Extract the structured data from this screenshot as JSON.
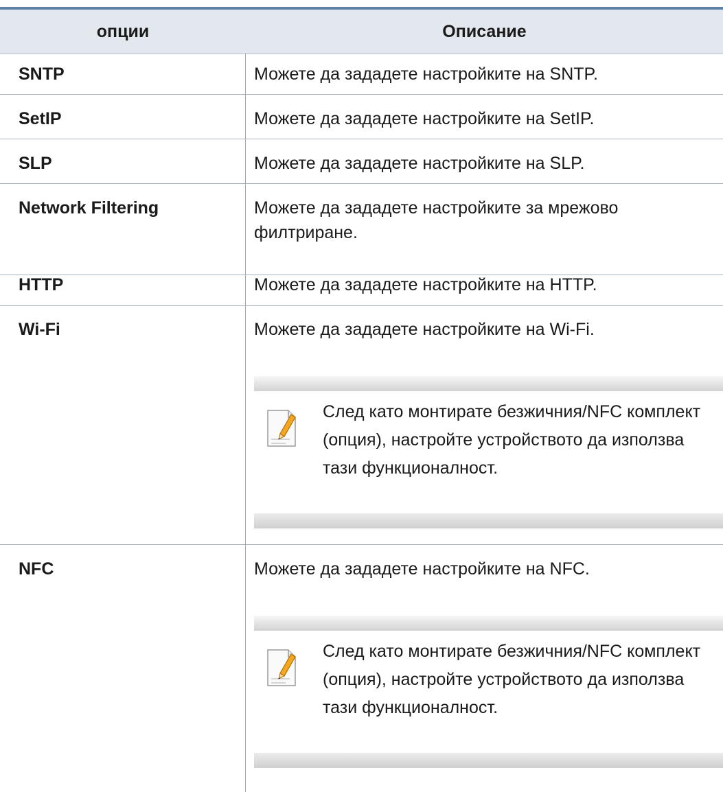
{
  "header": {
    "options_label": "опции",
    "description_label": "Описание"
  },
  "rows": [
    {
      "option": "SNTP",
      "description": "Можете да зададете настройките на SNTP."
    },
    {
      "option": "SetIP",
      "description": "Можете да зададете настройките на SetIP."
    },
    {
      "option": "SLP",
      "description": "Можете да зададете настройките на SLP."
    },
    {
      "option": "Network Filtering",
      "description": "Можете да зададете настройките за мрежово филтриране."
    },
    {
      "option": "HTTP",
      "description": "Можете да зададете настройките на HTTP."
    },
    {
      "option": "Wi-Fi",
      "description": "Можете да зададете настройките на Wi-Fi.",
      "note": "След като монтирате безжичния/NFC комплект (опция), настройте устройството да използва тази функционалност."
    },
    {
      "option": "NFC",
      "description": "Можете да зададете настройките на NFC.",
      "note": "След като монтирате безжичния/NFC комплект (опция), настройте устройството да използва тази функционалност."
    }
  ],
  "colors": {
    "accent_rule": "#5c7fa8",
    "header_bg": "#e3e7ee",
    "note_pencil": "#f5a623"
  },
  "icons": {
    "note": "note-pencil-icon"
  }
}
